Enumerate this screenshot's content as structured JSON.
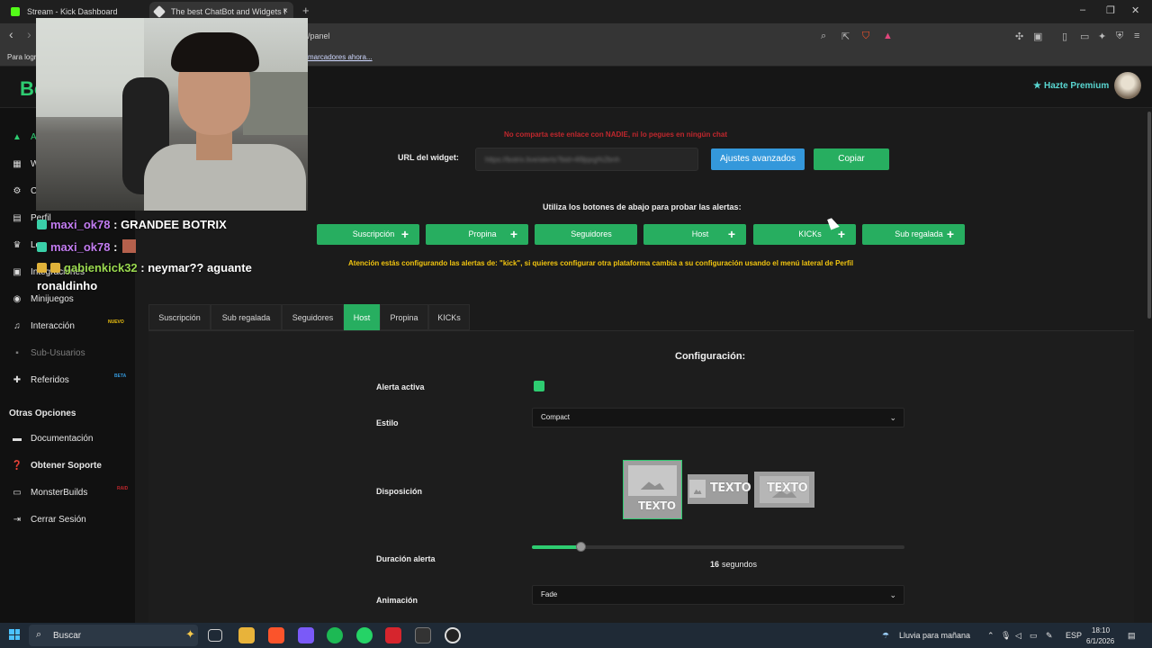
{
  "browser": {
    "tabs": [
      {
        "title": "Stream - Kick Dashboard",
        "close": "×"
      },
      {
        "title": "The best ChatBot and Widgets f",
        "close": "×"
      }
    ],
    "new_tab": "+",
    "url": "/panel",
    "bookmark_hint": "Para logr",
    "bookmark_link": "marcadores ahora...",
    "window_controls": [
      "–",
      "❐",
      "✕"
    ],
    "nav": {
      "back": "‹",
      "forward": "›"
    }
  },
  "site": {
    "brand": "Bo",
    "premium": "Hazte Premium",
    "premium_icon": "star-icon"
  },
  "sidebar": {
    "items": [
      {
        "label": "A",
        "icon": "alert-icon"
      },
      {
        "label": "W",
        "icon": "widgets-icon"
      },
      {
        "label": "C",
        "icon": "commands-icon"
      },
      {
        "label": "Perfil",
        "icon": "profile-icon"
      },
      {
        "label": "Lo",
        "icon": "trophy-icon"
      },
      {
        "label": "Integraciones",
        "icon": "integrations-icon"
      },
      {
        "label": "Minijuegos",
        "icon": "gamepad-icon"
      },
      {
        "label": "Interacción",
        "icon": "music-icon",
        "badge": "NUEVO"
      },
      {
        "label": "Sub-Usuarios",
        "icon": "users-icon",
        "muted": true
      },
      {
        "label": "Referidos",
        "icon": "referral-icon",
        "badge": "BETA"
      }
    ],
    "other_heading": "Otras Opciones",
    "other_items": [
      {
        "label": "Documentación",
        "icon": "docs-icon"
      },
      {
        "label": "Obtener Soporte",
        "icon": "support-icon"
      },
      {
        "label": "MonsterBuilds",
        "icon": "monitor-icon",
        "badge": "RAID"
      },
      {
        "label": "Cerrar Sesión",
        "icon": "logout-icon"
      }
    ]
  },
  "stream_chat": [
    {
      "user": "maxi_ok78",
      "text": ": GRANDEE BOTRIX"
    },
    {
      "user": "maxi_ok78",
      "text": ""
    },
    {
      "user": "gabienkick32",
      "text": ": neymar?? aguante",
      "continuation": "ronaldinho"
    }
  ],
  "widget": {
    "warning": "No comparta este enlace con NADIE, ni lo pegues en ningún chat",
    "url_label": "URL del widget:",
    "url_value": "https://botrix.live/alerts?bid=4l9jqxg%2bnh",
    "advanced_button": "Ajustes avanzados",
    "copy_button": "Copiar",
    "test_hint": "Utiliza los botones de abajo para probar las alertas:",
    "test_buttons": [
      {
        "label": "Suscripción",
        "plus": true
      },
      {
        "label": "Propina",
        "plus": true
      },
      {
        "label": "Seguidores",
        "plus": false
      },
      {
        "label": "Host",
        "plus": true
      },
      {
        "label": "KICKs",
        "plus": true
      },
      {
        "label": "Sub regalada",
        "plus": true
      }
    ],
    "attention": "Atención estás configurando las alertas de: \"kick\", si quieres configurar otra plataforma cambia a su configuración usando el menú lateral de Perfil"
  },
  "config_tabs": [
    "Suscripción",
    "Sub regalada",
    "Seguidores",
    "Host",
    "Propina",
    "KICKs"
  ],
  "active_tab": "Host",
  "config": {
    "title": "Configuración:",
    "active_label": "Alerta activa",
    "active_checked": true,
    "style_label": "Estilo",
    "style_value": "Compact",
    "layout_label": "Disposición",
    "layout_text": "TEXTO",
    "layout_selected": 0,
    "duration_label": "Duración alerta",
    "duration_value": "16",
    "duration_unit": "segundos",
    "duration_fraction": 0.13,
    "animation_label": "Animación",
    "animation_value": "Fade"
  },
  "taskbar": {
    "search_placeholder": "Buscar",
    "weather": "Lluvia para mañana",
    "lang": "ESP",
    "time": "18:10",
    "date": "6/1/2026"
  },
  "colors": {
    "accent": "#27ae60",
    "blue": "#3498db",
    "warning": "#c0272d",
    "attention": "#f1c40f",
    "premium": "#59d6d1"
  }
}
